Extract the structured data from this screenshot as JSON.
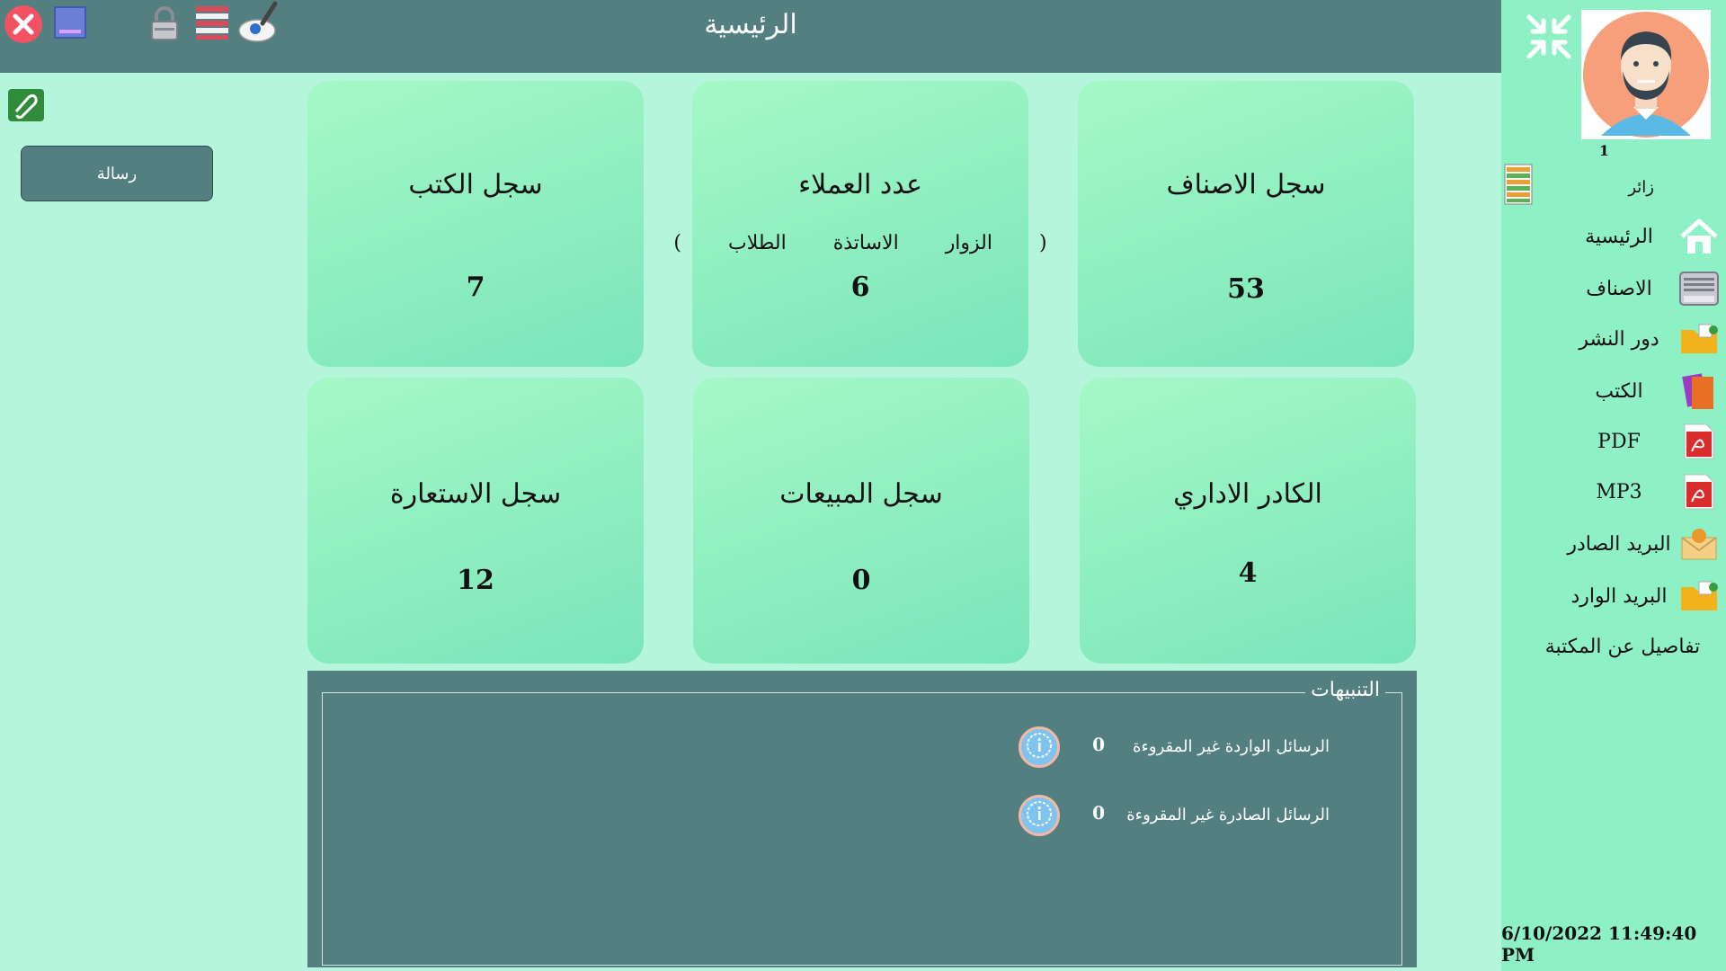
{
  "window": {
    "title": "الرئيسية"
  },
  "toolbar": {
    "icons": [
      "close-icon",
      "minimize-icon",
      "lock-icon",
      "flag-icon",
      "theme-brush-icon"
    ]
  },
  "user": {
    "id": "1",
    "role": "زائر"
  },
  "sidebar": {
    "items": [
      {
        "label": "الرئيسية",
        "icon": "home-icon"
      },
      {
        "label": "الاصناف",
        "icon": "categories-drawer-icon"
      },
      {
        "label": "دور النشر",
        "icon": "publishers-folder-icon"
      },
      {
        "label": "الكتب",
        "icon": "books-icon"
      },
      {
        "label": "PDF",
        "icon": "pdf-icon"
      },
      {
        "label": "MP3",
        "icon": "mp3-icon"
      },
      {
        "label": "البريد الصادر",
        "icon": "outbox-icon"
      },
      {
        "label": "البريد الوارد",
        "icon": "inbox-icon"
      },
      {
        "label": "تفاصيل عن المكتبة",
        "icon": ""
      }
    ],
    "datetime": "6/10/2022 11:49:40 PM"
  },
  "left": {
    "message_button": "رسالة"
  },
  "cards": {
    "categories": {
      "title": "سجل الاصناف",
      "value": "53"
    },
    "clients": {
      "title": "عدد العملاء",
      "sub_open": "(",
      "sub_visitors": "الزوار",
      "sub_teachers": "الاساتذة",
      "sub_students": "الطلاب",
      "sub_close": ")",
      "value": "6"
    },
    "books": {
      "title": "سجل الكتب",
      "value": "7"
    },
    "staff": {
      "title": "الكادر الاداري",
      "value": "4"
    },
    "sales": {
      "title": "سجل المبيعات",
      "value": "0"
    },
    "borrow": {
      "title": "سجل الاستعارة",
      "value": "12"
    }
  },
  "alerts": {
    "legend": "التنبيهات",
    "rows": [
      {
        "label": "الرسائل الواردة غير المقروءة",
        "count": "0"
      },
      {
        "label": "الرسائل الصادرة غير المقروءة",
        "count": "0"
      }
    ]
  },
  "colors": {
    "header": "#547f80",
    "background": "#b4f5dc",
    "sidebar": "#8ef0c5",
    "card": "#8ef0c5"
  }
}
